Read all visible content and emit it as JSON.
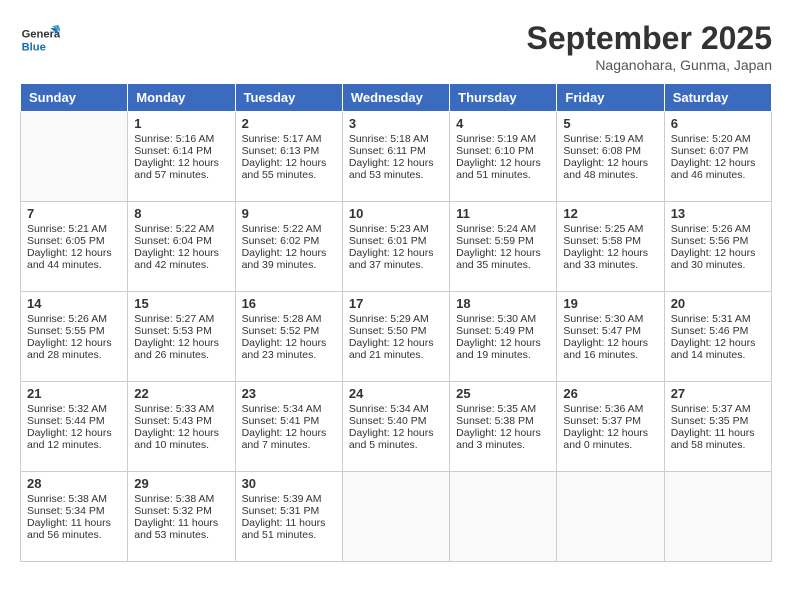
{
  "header": {
    "logo_line1": "General",
    "logo_line2": "Blue",
    "title": "September 2025",
    "subtitle": "Naganohara, Gunma, Japan"
  },
  "days": [
    "Sunday",
    "Monday",
    "Tuesday",
    "Wednesday",
    "Thursday",
    "Friday",
    "Saturday"
  ],
  "weeks": [
    [
      {
        "date": "",
        "text": ""
      },
      {
        "date": "1",
        "text": "Sunrise: 5:16 AM\nSunset: 6:14 PM\nDaylight: 12 hours\nand 57 minutes."
      },
      {
        "date": "2",
        "text": "Sunrise: 5:17 AM\nSunset: 6:13 PM\nDaylight: 12 hours\nand 55 minutes."
      },
      {
        "date": "3",
        "text": "Sunrise: 5:18 AM\nSunset: 6:11 PM\nDaylight: 12 hours\nand 53 minutes."
      },
      {
        "date": "4",
        "text": "Sunrise: 5:19 AM\nSunset: 6:10 PM\nDaylight: 12 hours\nand 51 minutes."
      },
      {
        "date": "5",
        "text": "Sunrise: 5:19 AM\nSunset: 6:08 PM\nDaylight: 12 hours\nand 48 minutes."
      },
      {
        "date": "6",
        "text": "Sunrise: 5:20 AM\nSunset: 6:07 PM\nDaylight: 12 hours\nand 46 minutes."
      }
    ],
    [
      {
        "date": "7",
        "text": "Sunrise: 5:21 AM\nSunset: 6:05 PM\nDaylight: 12 hours\nand 44 minutes."
      },
      {
        "date": "8",
        "text": "Sunrise: 5:22 AM\nSunset: 6:04 PM\nDaylight: 12 hours\nand 42 minutes."
      },
      {
        "date": "9",
        "text": "Sunrise: 5:22 AM\nSunset: 6:02 PM\nDaylight: 12 hours\nand 39 minutes."
      },
      {
        "date": "10",
        "text": "Sunrise: 5:23 AM\nSunset: 6:01 PM\nDaylight: 12 hours\nand 37 minutes."
      },
      {
        "date": "11",
        "text": "Sunrise: 5:24 AM\nSunset: 5:59 PM\nDaylight: 12 hours\nand 35 minutes."
      },
      {
        "date": "12",
        "text": "Sunrise: 5:25 AM\nSunset: 5:58 PM\nDaylight: 12 hours\nand 33 minutes."
      },
      {
        "date": "13",
        "text": "Sunrise: 5:26 AM\nSunset: 5:56 PM\nDaylight: 12 hours\nand 30 minutes."
      }
    ],
    [
      {
        "date": "14",
        "text": "Sunrise: 5:26 AM\nSunset: 5:55 PM\nDaylight: 12 hours\nand 28 minutes."
      },
      {
        "date": "15",
        "text": "Sunrise: 5:27 AM\nSunset: 5:53 PM\nDaylight: 12 hours\nand 26 minutes."
      },
      {
        "date": "16",
        "text": "Sunrise: 5:28 AM\nSunset: 5:52 PM\nDaylight: 12 hours\nand 23 minutes."
      },
      {
        "date": "17",
        "text": "Sunrise: 5:29 AM\nSunset: 5:50 PM\nDaylight: 12 hours\nand 21 minutes."
      },
      {
        "date": "18",
        "text": "Sunrise: 5:30 AM\nSunset: 5:49 PM\nDaylight: 12 hours\nand 19 minutes."
      },
      {
        "date": "19",
        "text": "Sunrise: 5:30 AM\nSunset: 5:47 PM\nDaylight: 12 hours\nand 16 minutes."
      },
      {
        "date": "20",
        "text": "Sunrise: 5:31 AM\nSunset: 5:46 PM\nDaylight: 12 hours\nand 14 minutes."
      }
    ],
    [
      {
        "date": "21",
        "text": "Sunrise: 5:32 AM\nSunset: 5:44 PM\nDaylight: 12 hours\nand 12 minutes."
      },
      {
        "date": "22",
        "text": "Sunrise: 5:33 AM\nSunset: 5:43 PM\nDaylight: 12 hours\nand 10 minutes."
      },
      {
        "date": "23",
        "text": "Sunrise: 5:34 AM\nSunset: 5:41 PM\nDaylight: 12 hours\nand 7 minutes."
      },
      {
        "date": "24",
        "text": "Sunrise: 5:34 AM\nSunset: 5:40 PM\nDaylight: 12 hours\nand 5 minutes."
      },
      {
        "date": "25",
        "text": "Sunrise: 5:35 AM\nSunset: 5:38 PM\nDaylight: 12 hours\nand 3 minutes."
      },
      {
        "date": "26",
        "text": "Sunrise: 5:36 AM\nSunset: 5:37 PM\nDaylight: 12 hours\nand 0 minutes."
      },
      {
        "date": "27",
        "text": "Sunrise: 5:37 AM\nSunset: 5:35 PM\nDaylight: 11 hours\nand 58 minutes."
      }
    ],
    [
      {
        "date": "28",
        "text": "Sunrise: 5:38 AM\nSunset: 5:34 PM\nDaylight: 11 hours\nand 56 minutes."
      },
      {
        "date": "29",
        "text": "Sunrise: 5:38 AM\nSunset: 5:32 PM\nDaylight: 11 hours\nand 53 minutes."
      },
      {
        "date": "30",
        "text": "Sunrise: 5:39 AM\nSunset: 5:31 PM\nDaylight: 11 hours\nand 51 minutes."
      },
      {
        "date": "",
        "text": ""
      },
      {
        "date": "",
        "text": ""
      },
      {
        "date": "",
        "text": ""
      },
      {
        "date": "",
        "text": ""
      }
    ]
  ]
}
